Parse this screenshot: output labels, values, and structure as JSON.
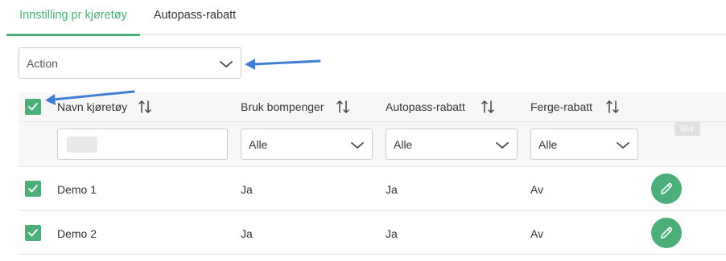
{
  "tabs": [
    {
      "label": "Innstilling pr kjøretøy",
      "active": true
    },
    {
      "label": "Autopass-rabatt",
      "active": false
    }
  ],
  "action_select": {
    "value": "Action",
    "icon": "chevron-down-icon"
  },
  "table": {
    "columns": [
      {
        "label": "Navn kjøretøy",
        "sort_icon": "sort-icon"
      },
      {
        "label": "Bruk bompenger",
        "sort_icon": "sort-icon"
      },
      {
        "label": "Autopass-rabatt",
        "sort_icon": "sort-icon"
      },
      {
        "label": "Ferge-rabatt",
        "sort_icon": "sort-icon"
      }
    ],
    "filters": {
      "name_input_value": "",
      "bompenger": "Alle",
      "autopass": "Alle",
      "ferge": "Alle"
    },
    "blur_badge": "Blur",
    "rows": [
      {
        "checked": true,
        "name": "Demo 1",
        "bompenger": "Ja",
        "autopass": "Ja",
        "ferge": "Av"
      },
      {
        "checked": true,
        "name": "Demo 2",
        "bompenger": "Ja",
        "autopass": "Ja",
        "ferge": "Av"
      }
    ]
  },
  "colors": {
    "accent": "#4caf7a",
    "annotation_arrow": "#3f7fd6",
    "header_band": "#f7f7f8"
  }
}
